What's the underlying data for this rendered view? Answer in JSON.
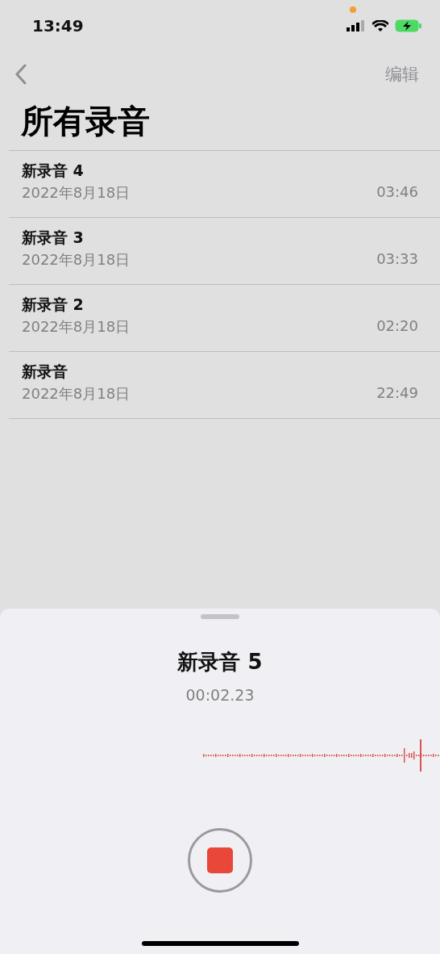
{
  "status_bar": {
    "time": "13:49"
  },
  "nav": {
    "edit": "编辑"
  },
  "title": "所有录音",
  "recordings": [
    {
      "name": "新录音 4",
      "date": "2022年8月18日",
      "duration": "03:46"
    },
    {
      "name": "新录音 3",
      "date": "2022年8月18日",
      "duration": "03:33"
    },
    {
      "name": "新录音 2",
      "date": "2022年8月18日",
      "duration": "02:20"
    },
    {
      "name": "新录音",
      "date": "2022年8月18日",
      "duration": "22:49"
    }
  ],
  "recorder": {
    "name": "新录音 5",
    "elapsed": "00:02.23",
    "recording": true
  }
}
